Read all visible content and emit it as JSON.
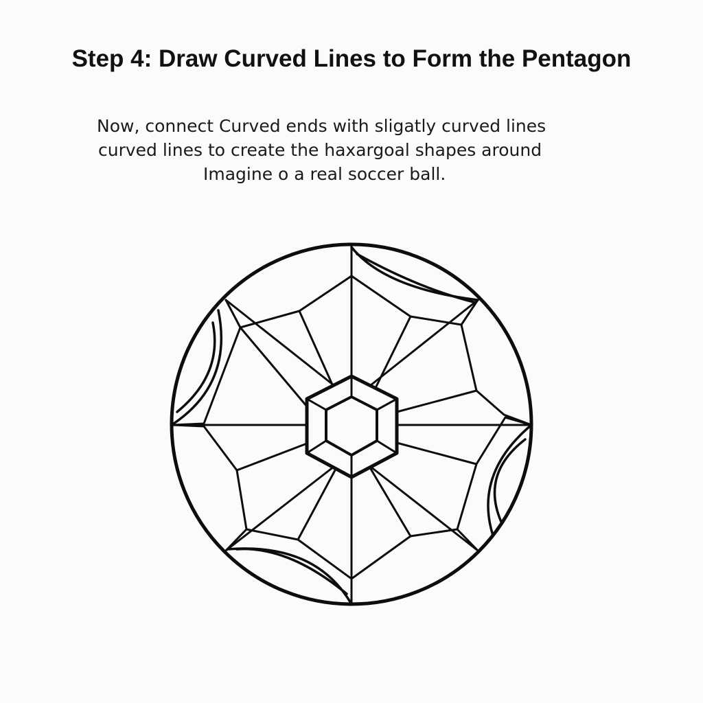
{
  "page": {
    "title": "Step 4: Draw Curved Lines to Form the Pentagon",
    "instructions": [
      "Now, connect Curved ends with sligatly curved lines",
      "curved lines to create the haxargoal shapes around",
      "Imagine o a real soccer ball."
    ]
  },
  "diagram": {
    "subject": "soccer ball line drawing",
    "colors": {
      "background": "#fbfbfb",
      "stroke": "#0d0d0d",
      "text": "#111111"
    }
  }
}
